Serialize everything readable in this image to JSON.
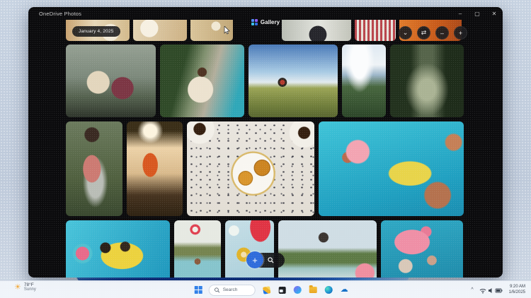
{
  "window": {
    "title": "OneDrive Photos",
    "minimize_glyph": "–",
    "maximize_glyph": "▢",
    "close_glyph": "✕"
  },
  "header": {
    "app_name": "Gallery",
    "date_pill": "January 4, 2025"
  },
  "view_controls": [
    {
      "name": "collapse",
      "glyph": "⌄"
    },
    {
      "name": "aspect-toggle",
      "glyph": "⇄"
    },
    {
      "name": "zoom-out",
      "glyph": "–"
    },
    {
      "name": "zoom-in",
      "glyph": "+"
    }
  ],
  "zoom_hint": {
    "plus_glyph": "+"
  },
  "gallery": {
    "rows": [
      {
        "photos": [
          {
            "id": "food-table-1",
            "label": "Table with food, cropped"
          },
          {
            "id": "food-table-2",
            "label": "Plates on table, cropped"
          },
          {
            "id": "picnic-table",
            "label": "Picnic table, cropped"
          },
          {
            "id": "camera-person",
            "label": "Person holding camera, cropped"
          },
          {
            "id": "plaid-people",
            "label": "People in plaid, cropped"
          },
          {
            "id": "orange-person",
            "label": "Person in orange, cropped"
          }
        ]
      },
      {
        "photos": [
          {
            "id": "couple-on-bikes",
            "label": "Couple laughing with bicycles"
          },
          {
            "id": "man-on-bike",
            "label": "Man riding bicycle by pool"
          },
          {
            "id": "hiker-overlook",
            "label": "Hiker with red backpack on overlook"
          },
          {
            "id": "mountain-clouds",
            "label": "Clouds over green mountain"
          },
          {
            "id": "forest-path",
            "label": "Sunlit forest path"
          }
        ]
      },
      {
        "photos": [
          {
            "id": "backpack-hiker",
            "label": "Hiker with pink backpack in forest"
          },
          {
            "id": "hammock-sunset",
            "label": "Orange hammock at sunset"
          },
          {
            "id": "pastries-coffee",
            "label": "Pastries and coffee on terrazzo table"
          },
          {
            "id": "pool-party",
            "label": "Friends on floats in pool"
          }
        ]
      },
      {
        "photos": [
          {
            "id": "dogs-on-float",
            "label": "Dogs on yellow pool float"
          },
          {
            "id": "beach-ball-pool",
            "label": "Beach ball tossed over pool"
          },
          {
            "id": "pool-inflatables",
            "label": "Flamingo and ring inflatables"
          },
          {
            "id": "pool-jump",
            "label": "Man jumping into pool"
          },
          {
            "id": "flamingo-float",
            "label": "Pink flamingo float in pool"
          }
        ]
      }
    ]
  },
  "taskbar": {
    "search_placeholder": "Search",
    "weather": {
      "temperature": "78°F",
      "condition": "Sunny"
    },
    "tray": {
      "expand_glyph": "^",
      "time": "9:20 AM",
      "date": "1/6/2025"
    }
  }
}
